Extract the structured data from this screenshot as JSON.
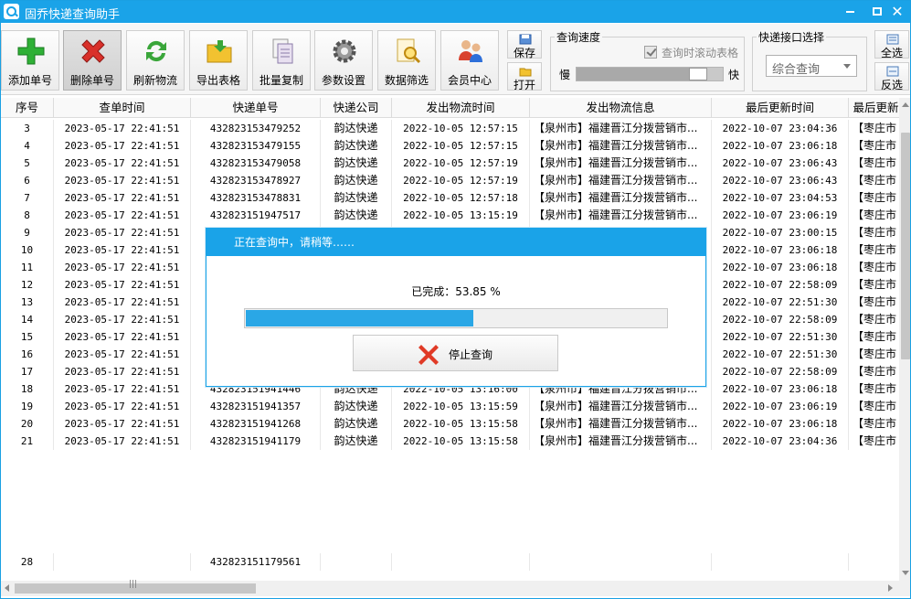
{
  "window": {
    "title": "固乔快递查询助手"
  },
  "toolbar": {
    "buttons": [
      {
        "label": "添加单号"
      },
      {
        "label": "删除单号"
      },
      {
        "label": "刷新物流"
      },
      {
        "label": "导出表格"
      },
      {
        "label": "批量复制"
      },
      {
        "label": "参数设置"
      },
      {
        "label": "数据筛选"
      },
      {
        "label": "会员中心"
      }
    ],
    "save_label": "保存",
    "open_label": "打开",
    "select_all_label": "全选",
    "invert_label": "反选"
  },
  "speed_group": {
    "title": "查询速度",
    "scroll_checkbox_label": "查询时滚动表格",
    "slow_label": "慢",
    "fast_label": "快",
    "speed_level_fraction": 0.88
  },
  "api_group": {
    "title": "快递接口选择",
    "selected": "综合查询"
  },
  "table": {
    "headers": [
      "序号",
      "查单时间",
      "快递单号",
      "快递公司",
      "发出物流时间",
      "发出物流信息",
      "最后更新时间",
      "最后更新"
    ],
    "rows": [
      [
        "3",
        "2023-05-17 22:41:51",
        "432823153479252",
        "韵达快递",
        "2022-10-05 12:57:15",
        "【泉州市】福建晋江分拨营销市...",
        "2022-10-07 23:04:36",
        "【枣庄市"
      ],
      [
        "4",
        "2023-05-17 22:41:51",
        "432823153479155",
        "韵达快递",
        "2022-10-05 12:57:15",
        "【泉州市】福建晋江分拨营销市...",
        "2022-10-07 23:06:18",
        "【枣庄市"
      ],
      [
        "5",
        "2023-05-17 22:41:51",
        "432823153479058",
        "韵达快递",
        "2022-10-05 12:57:19",
        "【泉州市】福建晋江分拨营销市...",
        "2022-10-07 23:06:43",
        "【枣庄市"
      ],
      [
        "6",
        "2023-05-17 22:41:51",
        "432823153478927",
        "韵达快递",
        "2022-10-05 12:57:19",
        "【泉州市】福建晋江分拨营销市...",
        "2022-10-07 23:06:43",
        "【枣庄市"
      ],
      [
        "7",
        "2023-05-17 22:41:51",
        "432823153478831",
        "韵达快递",
        "2022-10-05 12:57:18",
        "【泉州市】福建晋江分拨营销市...",
        "2022-10-07 23:04:53",
        "【枣庄市"
      ],
      [
        "8",
        "2023-05-17 22:41:51",
        "432823151947517",
        "韵达快递",
        "2022-10-05 13:15:19",
        "【泉州市】福建晋江分拨营销市...",
        "2022-10-07 23:06:19",
        "【枣庄市"
      ],
      [
        "9",
        "2023-05-17 22:41:51",
        "",
        "",
        "",
        "",
        "2022-10-07 23:00:15",
        "【枣庄市"
      ],
      [
        "10",
        "2023-05-17 22:41:51",
        "",
        "",
        "",
        "",
        "2022-10-07 23:06:18",
        "【枣庄市"
      ],
      [
        "11",
        "2023-05-17 22:41:51",
        "",
        "",
        "",
        "",
        "2022-10-07 23:06:18",
        "【枣庄市"
      ],
      [
        "12",
        "2023-05-17 22:41:51",
        "",
        "",
        "",
        "",
        "2022-10-07 22:58:09",
        "【枣庄市"
      ],
      [
        "13",
        "2023-05-17 22:41:51",
        "",
        "",
        "",
        "",
        "2022-10-07 22:51:30",
        "【枣庄市"
      ],
      [
        "14",
        "2023-05-17 22:41:51",
        "",
        "",
        "",
        "",
        "2022-10-07 22:58:09",
        "【枣庄市"
      ],
      [
        "15",
        "2023-05-17 22:41:51",
        "",
        "",
        "",
        "",
        "2022-10-07 22:51:30",
        "【枣庄市"
      ],
      [
        "16",
        "2023-05-17 22:41:51",
        "",
        "",
        "",
        "",
        "2022-10-07 22:51:30",
        "【枣庄市"
      ],
      [
        "17",
        "2023-05-17 22:41:51",
        "",
        "",
        "",
        "",
        "2022-10-07 22:58:09",
        "【枣庄市"
      ],
      [
        "18",
        "2023-05-17 22:41:51",
        "432823151941446",
        "韵达快递",
        "2022-10-05 13:16:00",
        "【泉州市】福建晋江分拨营销市...",
        "2022-10-07 23:06:18",
        "【枣庄市"
      ],
      [
        "19",
        "2023-05-17 22:41:51",
        "432823151941357",
        "韵达快递",
        "2022-10-05 13:15:59",
        "【泉州市】福建晋江分拨营销市...",
        "2022-10-07 23:06:19",
        "【枣庄市"
      ],
      [
        "20",
        "2023-05-17 22:41:51",
        "432823151941268",
        "韵达快递",
        "2022-10-05 13:15:58",
        "【泉州市】福建晋江分拨营销市...",
        "2022-10-07 23:06:18",
        "【枣庄市"
      ],
      [
        "21",
        "2023-05-17 22:41:51",
        "432823151941179",
        "韵达快递",
        "2022-10-05 13:15:58",
        "【泉州市】福建晋江分拨营销市...",
        "2022-10-07 23:04:36",
        "【枣庄市"
      ]
    ],
    "partial_row": [
      "28",
      "",
      "432823151179561",
      "",
      "",
      "",
      "",
      ""
    ]
  },
  "dialog": {
    "title": "正在查询中，请稍等……",
    "progress_text": "已完成：53.85 %",
    "progress_percent": 53.85,
    "stop_label": "停止查询"
  },
  "colors": {
    "titlebar": "#1aa3e8",
    "progress_fill": "#2aa7e6",
    "add_icon": "#2fb036",
    "delete_icon": "#d9302a"
  }
}
